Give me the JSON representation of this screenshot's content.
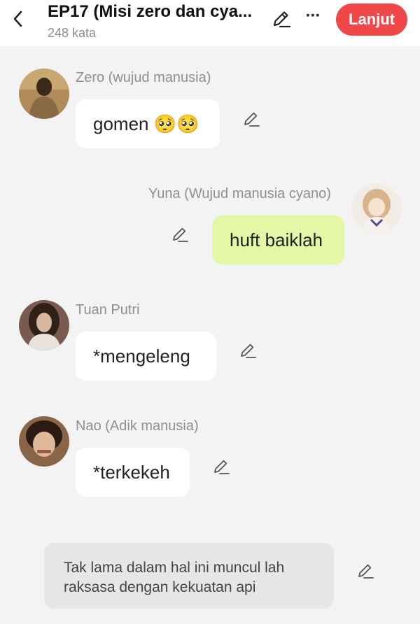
{
  "header": {
    "title": "EP17 (Misi zero dan cya...",
    "word_count": "248 kata",
    "next_label": "Lanjut",
    "more_label": "···",
    "back_icon": "chevron-left-icon",
    "edit_icon": "pencil-icon"
  },
  "messages": [
    {
      "speaker": "Zero (wujud manusia)",
      "text": "gomen 🥺🥺",
      "side": "left",
      "avatar_color": "#7a6140"
    },
    {
      "speaker": "Yuna (Wujud manusia cyano)",
      "text": "huft baiklah",
      "side": "right",
      "avatar_color": "#e8d3bc"
    },
    {
      "speaker": "Tuan Putri",
      "text": "*mengeleng",
      "side": "left",
      "avatar_color": "#5a4036"
    },
    {
      "speaker": "Nao (Adik manusia)",
      "text": "*terkekeh",
      "side": "left",
      "avatar_color": "#6b4a32"
    }
  ],
  "narration": {
    "text": "Tak lama dalam hal ini muncul lah raksasa dengan kekuatan api"
  },
  "colors": {
    "accent": "#f04848",
    "right_bubble": "#e4f7a6",
    "background": "#f3f3f3"
  }
}
